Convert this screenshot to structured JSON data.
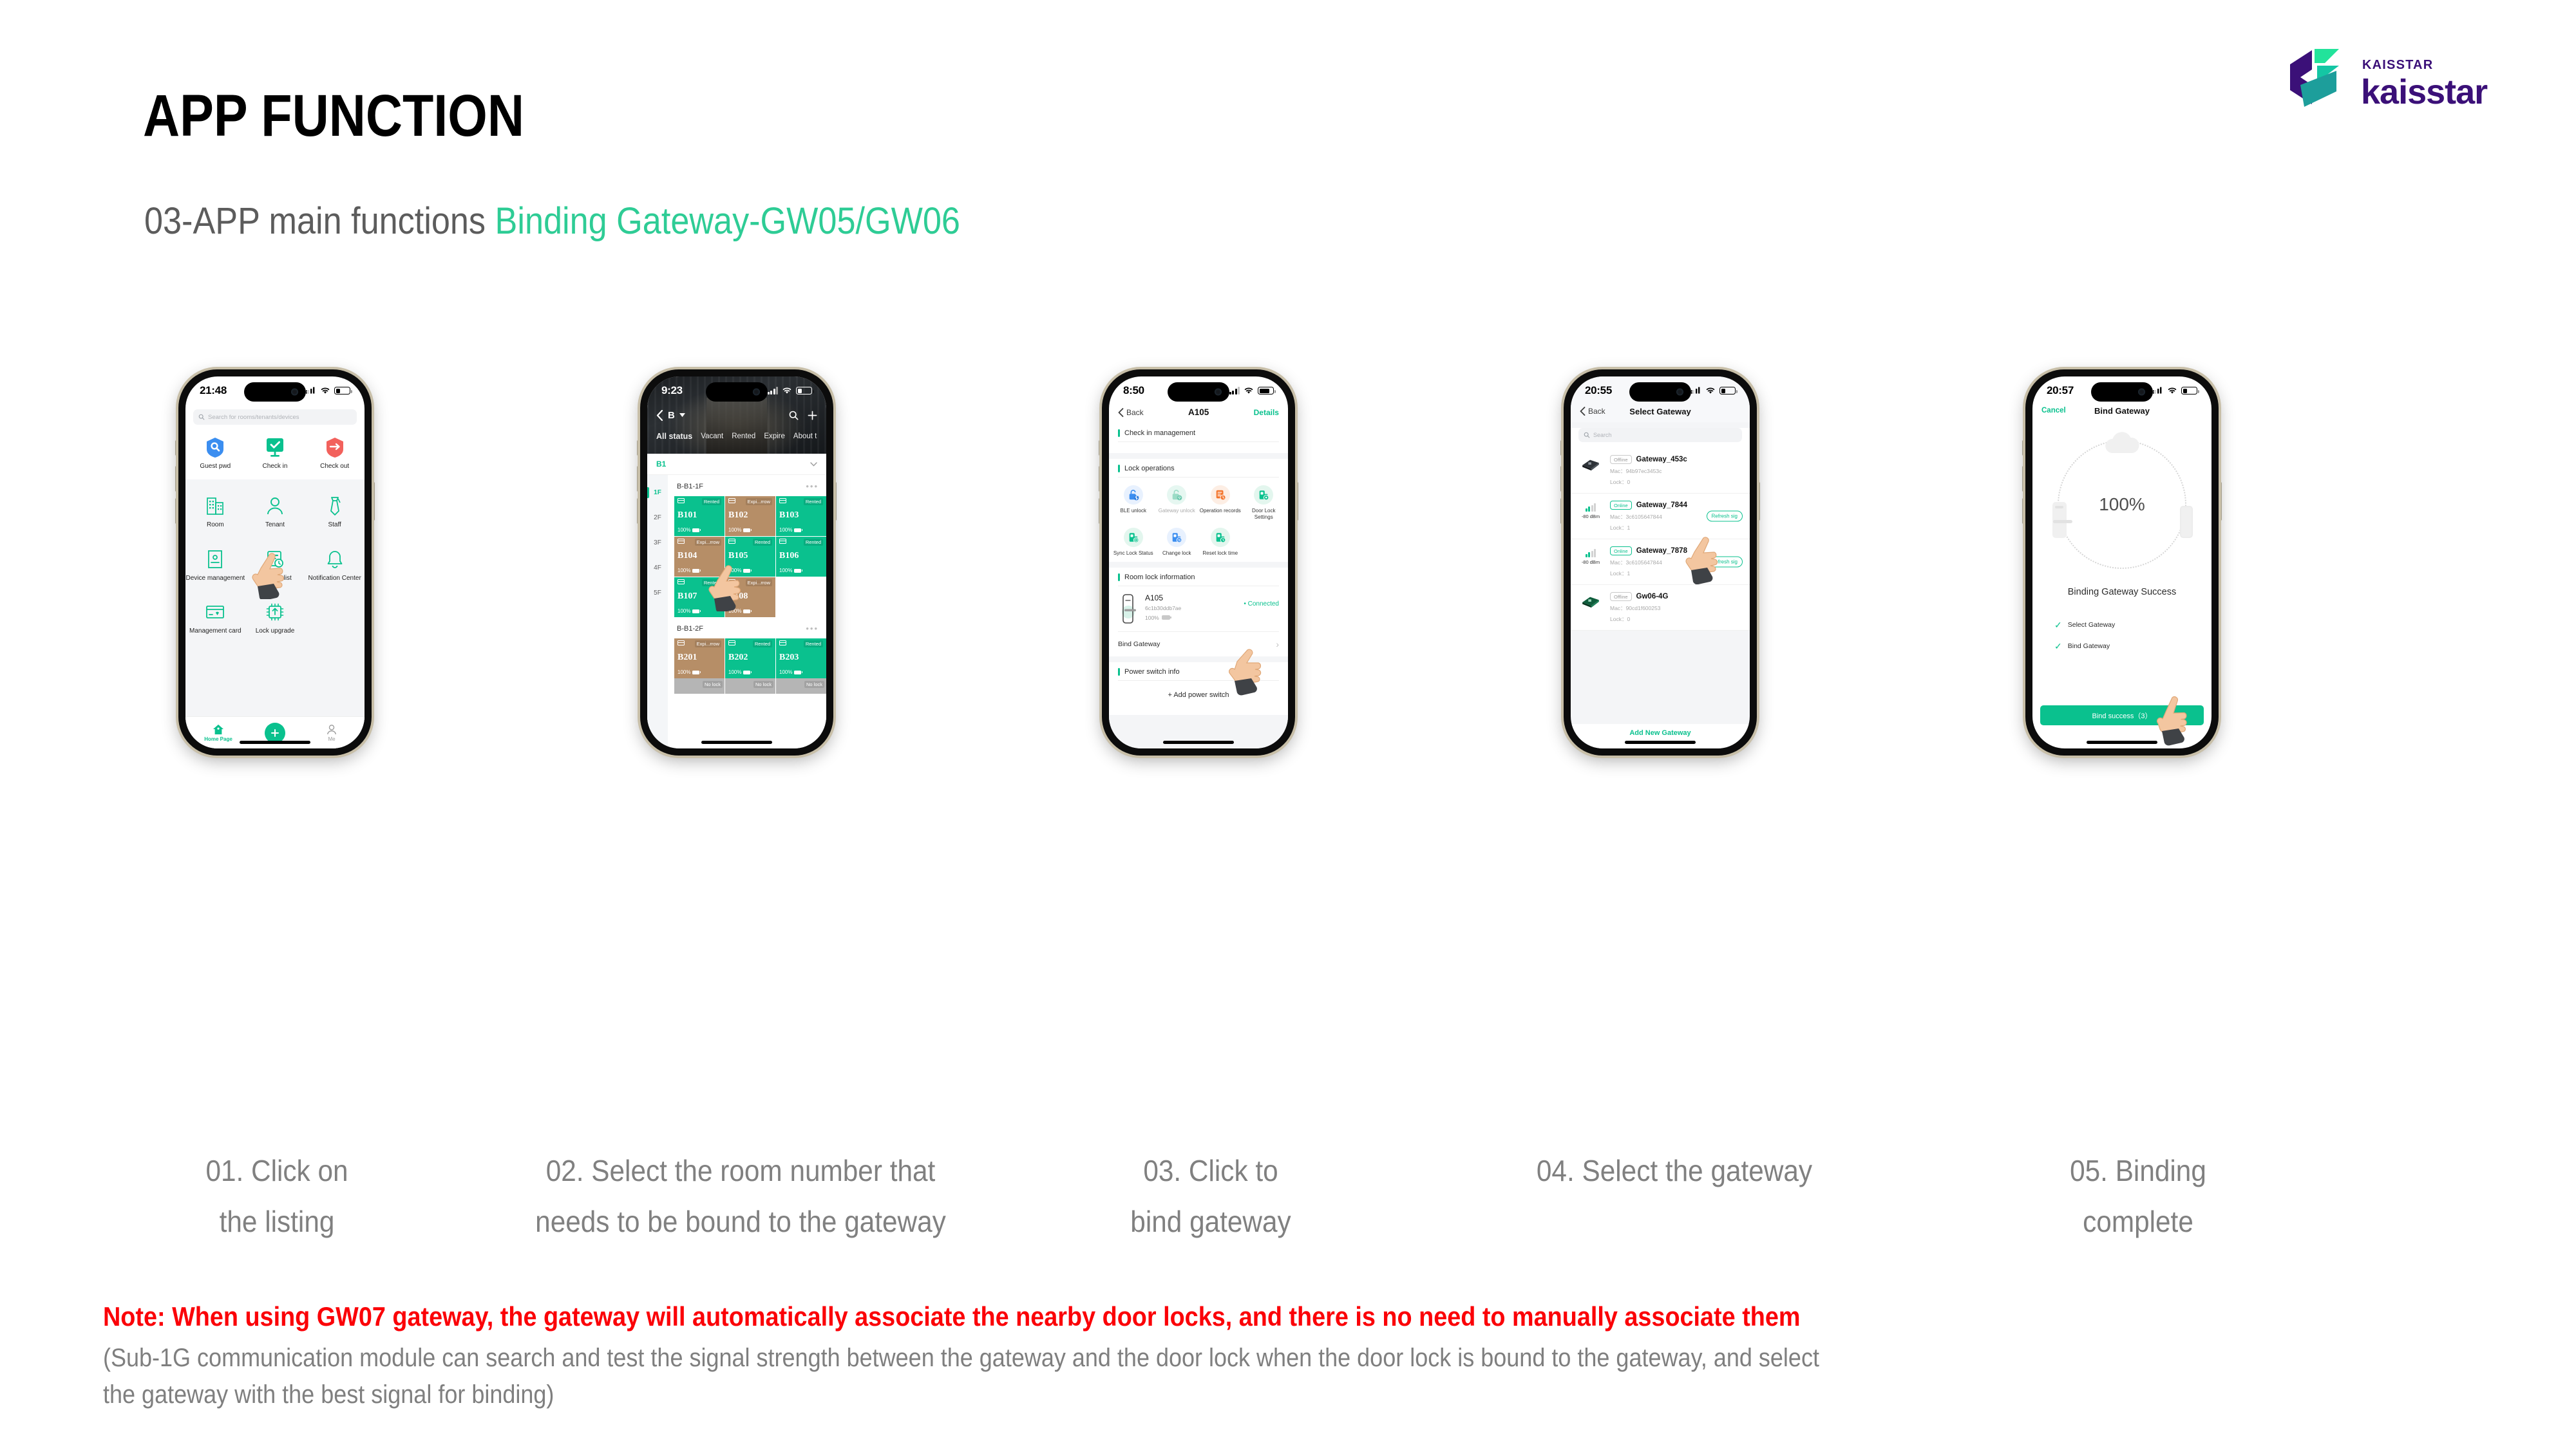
{
  "header": {
    "title": "APP FUNCTION",
    "subtitle_prefix": "03-APP main functions ",
    "subtitle_accent": "Binding Gateway-GW05/GW06",
    "accent_color": "#2ecc95"
  },
  "logo": {
    "small": "KAISSTAR",
    "big": "kaisstar",
    "brand_color": "#3b1078"
  },
  "phones": [
    {
      "status": {
        "time": "21:48"
      },
      "search_placeholder": "Search for rooms/tenants/devices",
      "top_tiles": [
        {
          "label": "Guest pwd",
          "icon": "shield-search-icon",
          "color": "#3b8ef0"
        },
        {
          "label": "Check in",
          "icon": "monitor-check-icon",
          "color": "#0ac18e"
        },
        {
          "label": "Check out",
          "icon": "exit-arrow-icon",
          "color": "#f2615c"
        }
      ],
      "menu_tiles": [
        {
          "label": "Room",
          "icon": "building-icon"
        },
        {
          "label": "Tenant",
          "icon": "person-icon"
        },
        {
          "label": "Staff",
          "icon": "tie-icon"
        },
        {
          "label": "Device management",
          "icon": "device-card-icon"
        },
        {
          "label": "Pending list",
          "icon": "doc-clock-icon"
        },
        {
          "label": "Notification Center",
          "icon": "bell-icon"
        },
        {
          "label": "Management card",
          "icon": "credit-card-icon"
        },
        {
          "label": "Lock upgrade",
          "icon": "chip-upgrade-icon"
        }
      ],
      "tabbar": [
        {
          "label": "Home Page",
          "icon": "home-icon",
          "active": true
        },
        {
          "label": "",
          "icon": "plus-icon",
          "active": false
        },
        {
          "label": "Me",
          "icon": "user-icon",
          "active": false
        }
      ]
    },
    {
      "status": {
        "time": "9:23"
      },
      "nav": {
        "building": "B",
        "search_icon": "search-icon",
        "add_icon": "plus-icon"
      },
      "tabs": [
        "All status",
        "Vacant",
        "Rented",
        "Expire",
        "About t"
      ],
      "floor_header": "B1",
      "floors": [
        "1F",
        "2F",
        "3F",
        "4F",
        "5F"
      ],
      "groups": [
        {
          "name": "B-B1-1F",
          "rooms": [
            {
              "name": "B101",
              "status": "Rented",
              "battery": "100%",
              "state": "rented"
            },
            {
              "name": "B102",
              "status": "Expi...rrow",
              "battery": "100%",
              "state": "expire"
            },
            {
              "name": "B103",
              "status": "Rented",
              "battery": "100%",
              "state": "rented"
            },
            {
              "name": "B104",
              "status": "Expi...rrow",
              "battery": "100%",
              "state": "expire"
            },
            {
              "name": "B105",
              "status": "Rented",
              "battery": "100%",
              "state": "rented"
            },
            {
              "name": "B106",
              "status": "Rented",
              "battery": "100%",
              "state": "rented"
            },
            {
              "name": "B107",
              "status": "Rented",
              "battery": "100%",
              "state": "rented"
            },
            {
              "name": "B108",
              "status": "Expi...rrow",
              "battery": "100%",
              "state": "expire"
            }
          ]
        },
        {
          "name": "B-B1-2F",
          "rooms": [
            {
              "name": "B201",
              "status": "Expi...rrow",
              "battery": "100%",
              "state": "expire"
            },
            {
              "name": "B202",
              "status": "Rented",
              "battery": "100%",
              "state": "rented"
            },
            {
              "name": "B203",
              "status": "Rented",
              "battery": "100%",
              "state": "rented"
            }
          ],
          "nolock_label": "No lock"
        }
      ]
    },
    {
      "status": {
        "time": "8:50"
      },
      "nav": {
        "back": "Back",
        "title": "A105",
        "details": "Details"
      },
      "sections": {
        "checkin": "Check in management",
        "lockops": "Lock operations",
        "roomlock": "Room lock information",
        "power": "Power switch info"
      },
      "operations": [
        {
          "label": "BLE unlock",
          "icon": "bluetooth-unlock-icon",
          "dim": false
        },
        {
          "label": "Gateway unlock",
          "icon": "wifi-unlock-icon",
          "dim": true
        },
        {
          "label": "Operation records",
          "icon": "records-clock-icon",
          "dim": false
        },
        {
          "label": "Door Lock Settings",
          "icon": "lock-gear-icon",
          "dim": false
        },
        {
          "label": "Sync Lock Status",
          "icon": "lock-sync-icon",
          "dim": false
        },
        {
          "label": "Change lock",
          "icon": "lock-swap-icon",
          "dim": false
        },
        {
          "label": "Reset lock time",
          "icon": "lock-clock-icon",
          "dim": false
        }
      ],
      "lock": {
        "name": "A105",
        "mac": "6c1b30ddb7ae",
        "battery": "100%",
        "status": "• Connected"
      },
      "bind_row": "Bind Gateway",
      "add_power": "+ Add power switch"
    },
    {
      "status": {
        "time": "20:55"
      },
      "nav": {
        "back": "Back",
        "title": "Select Gateway"
      },
      "search_placeholder": "Search",
      "gateways": [
        {
          "state": "Offline",
          "name": "Gateway_453c",
          "mac_label": "Mac：",
          "mac": "94b97ec3453c",
          "lock_label": "Lock：",
          "lock": "0",
          "signal": "",
          "refresh": ""
        },
        {
          "state": "Online",
          "name": "Gateway_7844",
          "mac_label": "Mac：",
          "mac": "3c6105647844",
          "lock_label": "Lock：",
          "lock": "1",
          "signal": "-80 dBm",
          "refresh": "Refresh sig"
        },
        {
          "state": "Online",
          "name": "Gateway_7878",
          "mac_label": "Mac：",
          "mac": "3c6105647844",
          "lock_label": "Lock：",
          "lock": "1",
          "signal": "-80 dBm",
          "refresh": "Refresh sig"
        },
        {
          "state": "Offline",
          "name": "Gw06-4G",
          "mac_label": "Mac：",
          "mac": "90cd1f600253",
          "lock_label": "Lock：",
          "lock": "0",
          "signal": "",
          "refresh": ""
        }
      ],
      "add_new": "Add New Gateway"
    },
    {
      "status": {
        "time": "20:57"
      },
      "nav": {
        "cancel": "Cancel",
        "title": "Bind Gateway"
      },
      "progress": "100%",
      "success_text": "Binding Gateway Success",
      "checks": [
        "Select Gateway",
        "Bind Gateway"
      ],
      "button": "Bind success（3）"
    }
  ],
  "captions": [
    {
      "line1": "01. Click on",
      "line2": "the listing"
    },
    {
      "line1": "02. Select the room number that",
      "line2": "needs to be bound to the gateway"
    },
    {
      "line1": "03. Click to",
      "line2": "bind gateway"
    },
    {
      "line1": "04. Select the gateway",
      "line2": ""
    },
    {
      "line1": "05. Binding",
      "line2": "complete"
    }
  ],
  "note": {
    "red": "Note: When using GW07 gateway, the gateway will automatically associate the nearby door locks, and there is no need to manually associate them",
    "grey_line1": "(Sub-1G communication module can search and test the signal strength between the gateway and the door lock when the door lock is bound to the gateway, and select",
    "grey_line2": "the gateway with the best signal for binding)",
    "red_color": "#fb0007"
  }
}
